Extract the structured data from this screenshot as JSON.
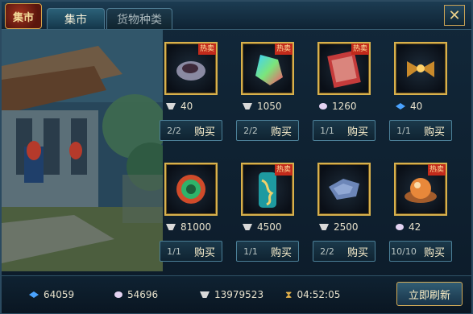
{
  "title": {
    "logo_text": "集市",
    "tabs": [
      {
        "label": "集市",
        "active": true
      },
      {
        "label": "货物种类",
        "active": false
      }
    ],
    "close_symbol": "✕"
  },
  "colors": {
    "gold": "#d8b14d",
    "panel_dark": "#0c1b29",
    "accent_blue": "#4b7f97",
    "tag_red": "#c22a1b"
  },
  "items": [
    {
      "name": "dark-ore",
      "price": "40",
      "currency": "silver",
      "stock": "2/2",
      "buy": "购买",
      "tag": "热卖"
    },
    {
      "name": "rainbow-crystal",
      "price": "1050",
      "currency": "silver",
      "stock": "2/2",
      "buy": "购买",
      "tag": "热卖"
    },
    {
      "name": "red-scroll",
      "price": "1260",
      "currency": "pearl",
      "stock": "1/1",
      "buy": "购买",
      "tag": "热卖"
    },
    {
      "name": "golden-bowtie",
      "price": "40",
      "currency": "gem",
      "stock": "1/1",
      "buy": "购买",
      "tag": ""
    },
    {
      "name": "jade-orb",
      "price": "81000",
      "currency": "silver",
      "stock": "1/1",
      "buy": "购买",
      "tag": ""
    },
    {
      "name": "teal-dragon-scroll",
      "price": "4500",
      "currency": "silver",
      "stock": "1/1",
      "buy": "购买",
      "tag": "热卖"
    },
    {
      "name": "blue-stone",
      "price": "2500",
      "currency": "silver",
      "stock": "2/2",
      "buy": "购买",
      "tag": ""
    },
    {
      "name": "amber-pearl",
      "price": "42",
      "currency": "pearl",
      "stock": "10/10",
      "buy": "购买",
      "tag": "热卖"
    }
  ],
  "footer": {
    "gem": "64059",
    "pearl": "54696",
    "silver": "13979523",
    "timer": "04:52:05",
    "refresh": "立即刷新"
  }
}
